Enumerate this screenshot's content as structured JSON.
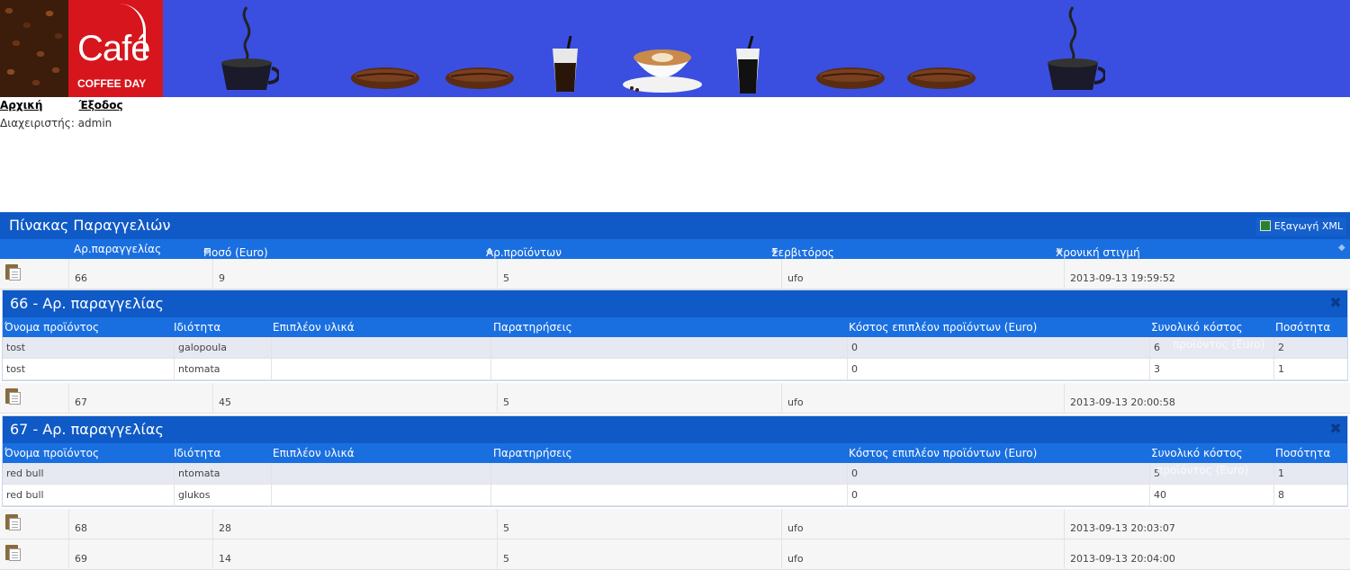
{
  "header": {
    "logo_main": "Café",
    "logo_sub": "COFFEE DAY"
  },
  "nav": {
    "home": "Αρχική",
    "logout": "Έξοδος",
    "admin_label": "Διαχειριστής: admin"
  },
  "grid": {
    "title": "Πίνακας Παραγγελιών",
    "export_label": "Εξαγωγή XML",
    "columns": [
      "Αρ.παραγγελίας",
      "Ποσό (Euro)",
      "Αρ.προϊόντων",
      "Σερβιτόρος",
      "Χρονική στιγμή"
    ],
    "rows": [
      {
        "order": "66",
        "amount": "9",
        "products": "5",
        "waiter": "ufo",
        "time": "2013-09-13 19:59:52"
      },
      {
        "order": "67",
        "amount": "45",
        "products": "5",
        "waiter": "ufo",
        "time": "2013-09-13 20:00:58"
      },
      {
        "order": "68",
        "amount": "28",
        "products": "5",
        "waiter": "ufo",
        "time": "2013-09-13 20:03:07"
      },
      {
        "order": "69",
        "amount": "14",
        "products": "5",
        "waiter": "ufo",
        "time": "2013-09-13 20:04:00"
      }
    ]
  },
  "detail_columns": [
    "Όνομα προϊόντος",
    "Ιδιότητα",
    "Επιπλέον υλικά",
    "Παρατηρήσεις",
    "Κόστος επιπλέον προϊόντων (Euro)",
    "Συνολικό κόστος",
    "Ποσότητα"
  ],
  "detail_ghost": "προϊόντος (Euro)",
  "details": [
    {
      "title": "66 - Αρ. παραγγελίας",
      "rows": [
        {
          "name": "tost",
          "prop": "galopoula",
          "extra": "",
          "notes": "",
          "extra_cost": "0",
          "total": "6",
          "qty": "2"
        },
        {
          "name": "tost",
          "prop": "ntomata",
          "extra": "",
          "notes": "",
          "extra_cost": "0",
          "total": "3",
          "qty": "1"
        }
      ]
    },
    {
      "title": "67 - Αρ. παραγγελίας",
      "rows": [
        {
          "name": "red bull",
          "prop": "ntomata",
          "extra": "",
          "notes": "",
          "extra_cost": "0",
          "total": "5",
          "qty": "1"
        },
        {
          "name": "red bull",
          "prop": "glukos",
          "extra": "",
          "notes": "",
          "extra_cost": "0",
          "total": "40",
          "qty": "8"
        }
      ]
    }
  ]
}
